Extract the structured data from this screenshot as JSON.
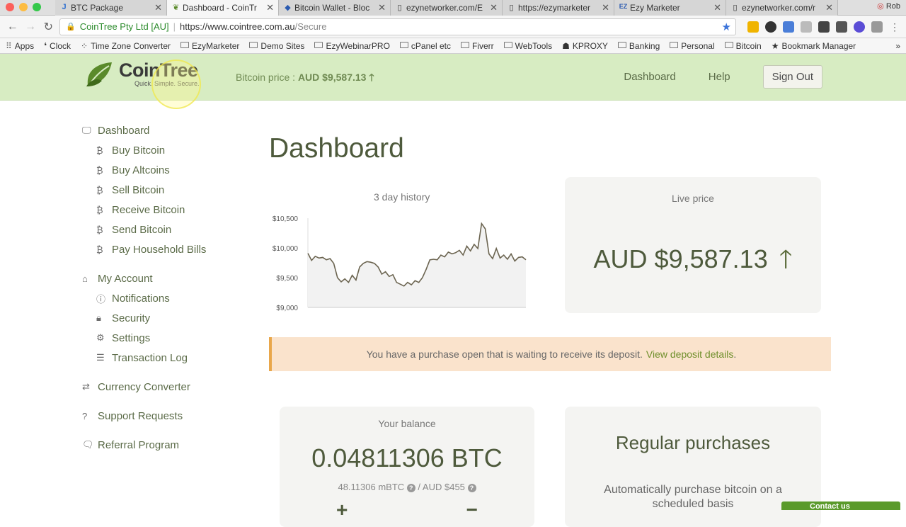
{
  "browser": {
    "tabs": [
      {
        "label": "BTC Package",
        "icon": "J",
        "active": false
      },
      {
        "label": "Dashboard - CoinTr",
        "icon": "leaf",
        "active": true
      },
      {
        "label": "Bitcoin Wallet - Bloc",
        "icon": "diamond",
        "active": false
      },
      {
        "label": "ezynetworker.com/E",
        "icon": "page",
        "active": false
      },
      {
        "label": "https://ezymarketer",
        "icon": "page",
        "active": false
      },
      {
        "label": "Ezy Marketer",
        "icon": "EZ",
        "active": false
      },
      {
        "label": "ezynetworker.com/r",
        "icon": "page",
        "active": false
      }
    ],
    "profile": "Rob",
    "omnibox": {
      "secure_label": "CoinTree Pty Ltd [AU]",
      "url_host": "https://www.cointree.com.au",
      "url_path": "/Secure"
    },
    "bookmarks": [
      {
        "label": "Apps",
        "icon": "grid"
      },
      {
        "label": "Clock",
        "icon": "clock"
      },
      {
        "label": "Time Zone Converter",
        "icon": "dots"
      },
      {
        "label": "EzyMarketer",
        "icon": "folder"
      },
      {
        "label": "Demo Sites",
        "icon": "folder"
      },
      {
        "label": "EzyWebinarPRO",
        "icon": "folder"
      },
      {
        "label": "cPanel etc",
        "icon": "folder"
      },
      {
        "label": "Fiverr",
        "icon": "folder"
      },
      {
        "label": "WebTools",
        "icon": "folder"
      },
      {
        "label": "KPROXY",
        "icon": "proxy"
      },
      {
        "label": "Banking",
        "icon": "folder"
      },
      {
        "label": "Personal",
        "icon": "folder"
      },
      {
        "label": "Bitcoin",
        "icon": "folder"
      },
      {
        "label": "Bookmark Manager",
        "icon": "star"
      }
    ]
  },
  "header": {
    "logo_name": "CoinTree",
    "logo_tagline": "Quick. Simple. Secure.",
    "price_label": "Bitcoin price : ",
    "price_value": "AUD $9,587.13",
    "nav": {
      "dashboard": "Dashboard",
      "help": "Help",
      "signout": "Sign Out"
    }
  },
  "sidebar": {
    "dashboard": "Dashboard",
    "dashboard_items": [
      "Buy Bitcoin",
      "Buy Altcoins",
      "Sell Bitcoin",
      "Receive Bitcoin",
      "Send Bitcoin",
      "Pay Household Bills"
    ],
    "account": "My Account",
    "account_items": [
      "Notifications",
      "Security",
      "Settings",
      "Transaction Log"
    ],
    "currency": "Currency Converter",
    "support": "Support Requests",
    "referral": "Referral Program"
  },
  "main": {
    "title": "Dashboard",
    "history_title": "3 day history",
    "live_title": "Live price",
    "live_price": "AUD $9,587.13",
    "alert_text": "You have a purchase open that is waiting to receive its deposit.",
    "alert_link": "View deposit details",
    "alert_end": ".",
    "balance_title": "Your balance",
    "balance_btc": "0.04811306 BTC",
    "balance_mbtc": "48.11306 mBTC",
    "balance_aud": "AUD $455",
    "regular_title": "Regular purchases",
    "regular_desc": "Automatically purchase bitcoin on a scheduled basis",
    "contact": "Contact us"
  },
  "chart_data": {
    "type": "area",
    "ylim": [
      9000,
      10500
    ],
    "yticks": [
      10500,
      10000,
      9500,
      9000
    ],
    "ytick_labels": [
      "$10,500",
      "$10,000",
      "$9,500",
      "$9,000"
    ],
    "values": [
      9910,
      9790,
      9860,
      9830,
      9840,
      9800,
      9820,
      9740,
      9500,
      9430,
      9480,
      9420,
      9540,
      9460,
      9680,
      9740,
      9770,
      9760,
      9740,
      9680,
      9560,
      9600,
      9520,
      9550,
      9420,
      9390,
      9360,
      9420,
      9380,
      9450,
      9420,
      9500,
      9640,
      9800,
      9810,
      9800,
      9880,
      9850,
      9930,
      9900,
      9920,
      9960,
      9880,
      10030,
      9950,
      10060,
      9990,
      10410,
      10320,
      9900,
      9820,
      9990,
      9830,
      9880,
      9810,
      9900,
      9780,
      9840,
      9850,
      9800
    ]
  },
  "colors": {
    "header_bg": "#d7ecc2",
    "accent_green": "#6f8f2b",
    "text_olive": "#4e5a3c",
    "alert_bg": "#fae3cc",
    "alert_border": "#e9a74b"
  }
}
